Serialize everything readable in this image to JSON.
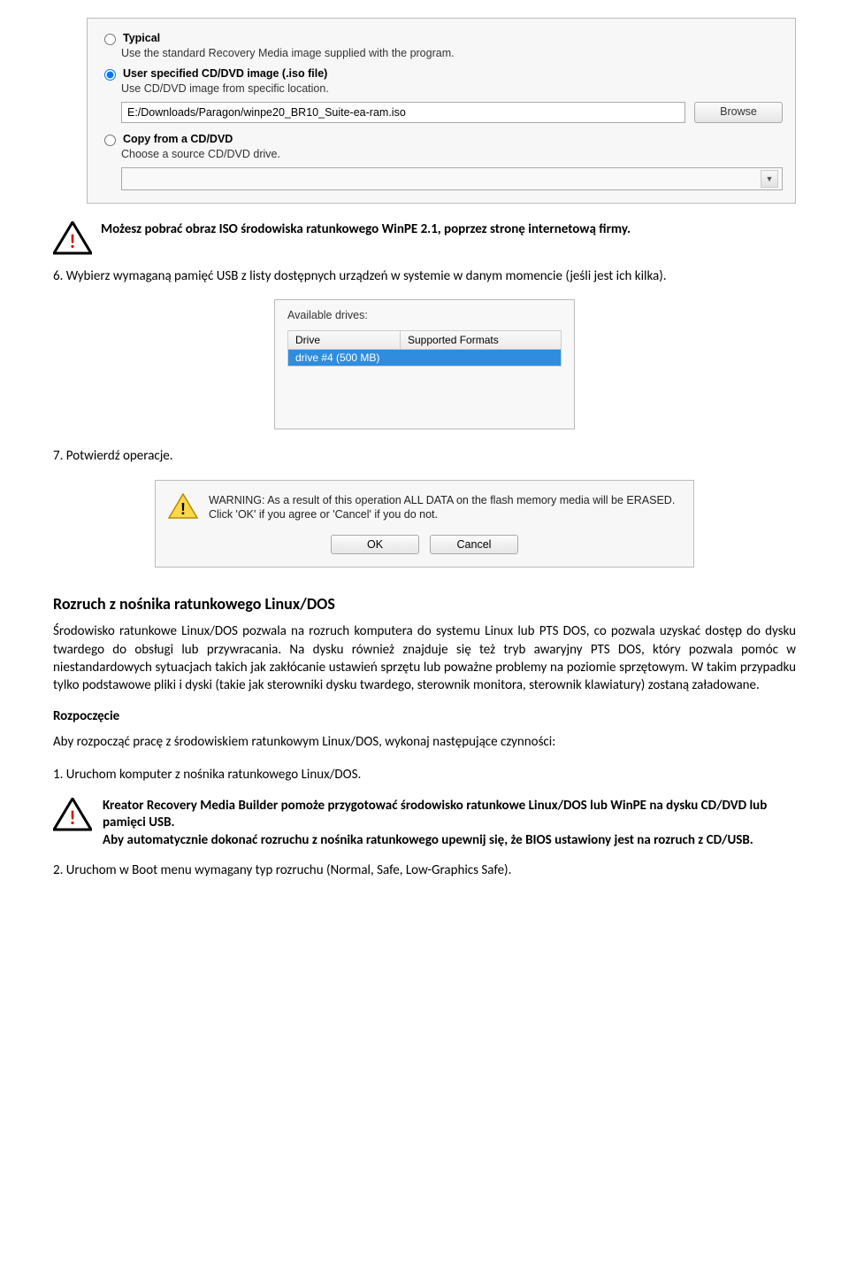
{
  "panel1": {
    "opt1_label": "Typical",
    "opt1_desc": "Use the standard Recovery Media image supplied with the program.",
    "opt2_label": "User specified CD/DVD image (.iso file)",
    "opt2_desc": "Use CD/DVD image from specific location.",
    "path_value": "E:/Downloads/Paragon/winpe20_BR10_Suite-ea-ram.iso",
    "browse_label": "Browse",
    "opt3_label": "Copy from a CD/DVD",
    "opt3_desc": "Choose a source CD/DVD drive."
  },
  "warn1": "Możesz pobrać obraz ISO środowiska ratunkowego WinPE 2.1, poprzez stronę internetową firmy.",
  "step6": "6. Wybierz wymaganą pamięć USB z listy dostępnych urządzeń w systemie w danym momencie (jeśli jest ich kilka).",
  "drives": {
    "caption": "Available drives:",
    "col1": "Drive",
    "col2": "Supported Formats",
    "row1": "drive #4 (500 MB)"
  },
  "step7": "7. Potwierdź operacje.",
  "dialog": {
    "text": "WARNING: As a result of this operation ALL DATA on the flash memory media will be ERASED. Click 'OK' if you agree or 'Cancel' if you do not.",
    "ok": "OK",
    "cancel": "Cancel"
  },
  "section_title": "Rozruch z nośnika ratunkowego Linux/DOS",
  "section_body": "Środowisko ratunkowe Linux/DOS  pozwala na rozruch komputera do systemu Linux lub PTS DOS, co pozwala  uzyskać dostęp do dysku twardego do obsługi lub przywracania. Na dysku również znajduje się też tryb awaryjny PTS DOS, który pozwala pomóc w niestandardowych sytuacjach takich jak zakłócanie ustawień sprzętu lub poważne problemy na poziomie sprzętowym. W takim przypadku tylko podstawowe pliki i dyski (takie jak sterowniki dysku twardego, sterownik monitora, sterownik klawiatury) zostaną załadowane.",
  "rozpoczecie": "Rozpoczęcie",
  "rozp_text": "Aby rozpocząć pracę z  środowiskiem ratunkowym Linux/DOS, wykonaj następujące czynności:",
  "step_b1": "1. Uruchom komputer z nośnika ratunkowego Linux/DOS.",
  "warn2_line1": "Kreator Recovery Media Builder pomoże przygotować środowisko ratunkowe Linux/DOS lub WinPE na dysku CD/DVD lub pamięci USB.",
  "warn2_line2": "Aby automatycznie dokonać rozruchu z nośnika ratunkowego upewnij się, że BIOS ustawiony jest na rozruch z CD/USB.",
  "step_b2": "2. Uruchom w Boot menu wymagany typ rozruchu (Normal, Safe, Low-Graphics Safe)."
}
